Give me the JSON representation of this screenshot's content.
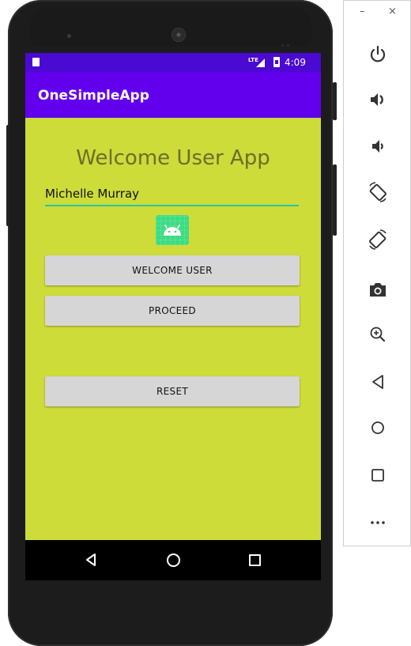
{
  "statusbar": {
    "network": "LTE",
    "time": "4:09"
  },
  "app": {
    "title": "OneSimpleApp"
  },
  "content": {
    "heading": "Welcome User App",
    "name_value": "Michelle Murray",
    "buttons": {
      "welcome": "WELCOME USER",
      "proceed": "PROCEED",
      "reset": "RESET"
    }
  },
  "emulator_toolbar": {
    "minimize": "–",
    "close": "×",
    "icons": [
      "power-icon",
      "volume-up-icon",
      "volume-down-icon",
      "rotate-left-icon",
      "rotate-right-icon",
      "camera-icon",
      "zoom-icon",
      "back-icon",
      "home-icon",
      "overview-icon",
      "more-icon"
    ]
  },
  "colors": {
    "status_bar": "#4a0ad1",
    "app_bar": "#6200ee",
    "content_background": "#cddc39",
    "heading_text": "#6b6f2a",
    "input_underline": "#26c6a6",
    "button_background": "#d6d6d6",
    "android_icon": "#3ddc84"
  }
}
